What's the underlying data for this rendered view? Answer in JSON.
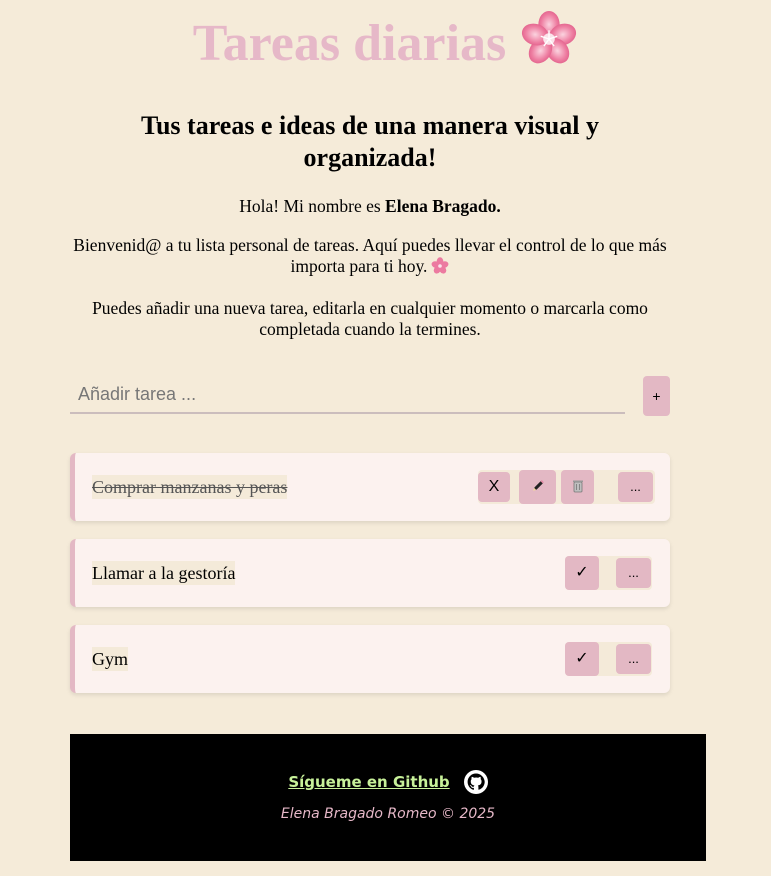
{
  "header": {
    "title": "Tareas diarias",
    "title_icon": "cherry-blossom-icon",
    "subtitle": "Tus tareas e ideas de una manera visual y organizada!"
  },
  "intro": {
    "greeting_prefix": "Hola! Mi nombre es ",
    "author_name": "Elena Bragado.",
    "welcome_text": "Bienvenid@ a tu lista personal de tareas. Aquí puedes llevar el control de lo que más importa para ti hoy.",
    "welcome_icon": "cherry-blossom-icon",
    "instructions": "Puedes añadir una nueva tarea, editarla en cualquier momento o marcarla como completada cuando la termines."
  },
  "add_task": {
    "placeholder": "Añadir tarea ...",
    "value": "",
    "add_label": "+"
  },
  "tasks": [
    {
      "text": "Comprar manzanas y peras",
      "completed": true,
      "buttons": {
        "undo": "X",
        "edit_icon": "pencil-icon",
        "delete_icon": "trash-icon",
        "more": "..."
      }
    },
    {
      "text": "Llamar a la gestoría",
      "completed": false,
      "buttons": {
        "complete": "✓",
        "more": "..."
      }
    },
    {
      "text": "Gym",
      "completed": false,
      "buttons": {
        "complete": "✓",
        "more": "..."
      }
    }
  ],
  "footer": {
    "github_label": "Sígueme en Github",
    "github_icon": "github-icon",
    "copyright": "Elena Bragado Romeo © 2025"
  },
  "colors": {
    "background": "#f5ebd9",
    "accent_pink": "#e3b8c4",
    "title_pink": "#e6b8c8",
    "card_background": "#fcf2ef",
    "footer_background": "#000000",
    "link_green": "#c8f29a"
  }
}
